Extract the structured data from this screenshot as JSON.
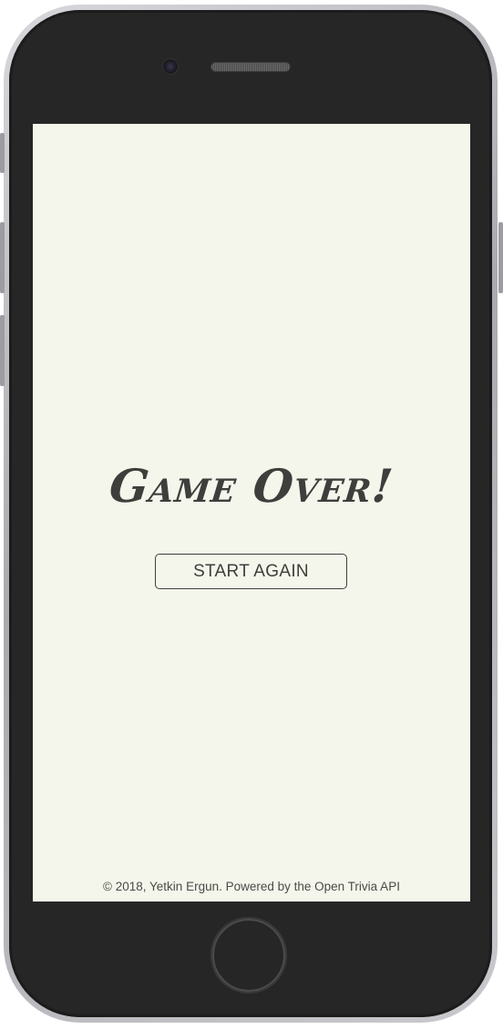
{
  "game_over": {
    "title": "Game Over!",
    "start_again_label": "START AGAIN"
  },
  "footer": {
    "text": "© 2018, Yetkin Ergun. Powered by the Open Trivia API"
  },
  "colors": {
    "screen_background": "#f5f6eb",
    "text": "#3e3e3c",
    "device_body": "#262626"
  },
  "icons": {
    "camera": "camera-icon",
    "speaker": "speaker-grille-icon",
    "home": "home-button-icon"
  }
}
